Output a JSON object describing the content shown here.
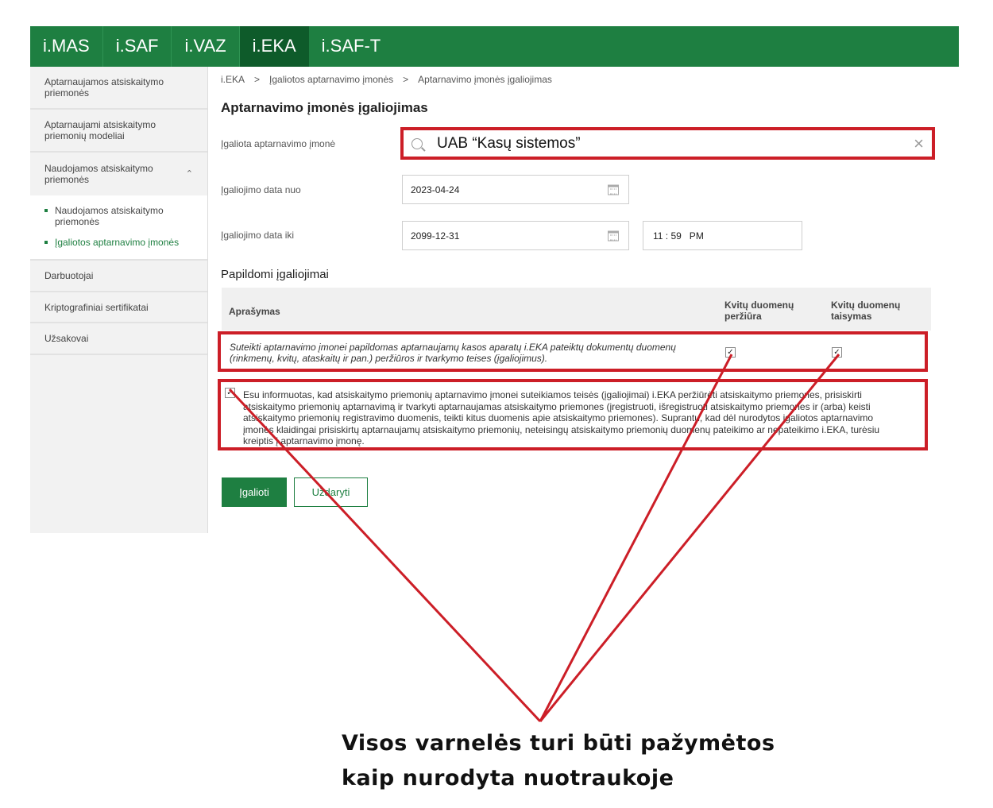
{
  "topnav": {
    "tabs": [
      {
        "label": "i.MAS"
      },
      {
        "label": "i.SAF"
      },
      {
        "label": "i.VAZ"
      },
      {
        "label": "i.EKA"
      },
      {
        "label": "i.SAF-T"
      }
    ],
    "active_tab": "i.EKA",
    "color": "#1e7f41",
    "active_color": "#0e5b2a"
  },
  "sidebar": {
    "items": [
      {
        "label": "Aptarnaujamos atsiskaitymo priemonės"
      },
      {
        "label": "Aptarnaujami atsiskaitymo priemonių modeliai"
      },
      {
        "label": "Naudojamos atsiskaitymo priemonės",
        "expanded": true,
        "icon": "chevron-up-icon"
      }
    ],
    "sub_items": [
      {
        "label": "Naudojamos atsiskaitymo priemonės"
      },
      {
        "label": "Įgaliotos aptarnavimo įmonės",
        "active": true
      }
    ],
    "items_after": [
      {
        "label": "Darbuotojai"
      },
      {
        "label": "Kriptografiniai sertifikatai"
      },
      {
        "label": "Užsakovai"
      }
    ]
  },
  "breadcrumb": {
    "items": [
      "i.EKA",
      "Įgaliotos aptarnavimo įmonės",
      "Aptarnavimo įmonės įgaliojimas"
    ],
    "separator": ">"
  },
  "page_title": "Aptarnavimo įmonės įgaliojimas",
  "form": {
    "company_label": "Įgaliota aptarnavimo įmonė",
    "company_value": "UAB “Kasų sistemos”",
    "date_from_label": "Įgaliojimo data nuo",
    "date_from_value": "2023-04-24",
    "date_to_label": "Įgaliojimo data iki",
    "date_to_value": "2099-12-31",
    "time_value": "11 : 59   PM"
  },
  "additional": {
    "title": "Papildomi įgaliojimai",
    "headers": {
      "description": "Aprašymas",
      "view": "Kvitų duomenų peržiūra",
      "edit": "Kvitų duomenų taisymas"
    },
    "row": {
      "description": "Suteikti aptarnavimo įmonei papildomas aptarnaujamų kasos aparatų i.EKA pateiktų dokumentų duomenų (rinkmenų, kvitų, ataskaitų ir pan.) peržiūros ir tvarkymo teises (įgaliojimus).",
      "view_checked": true,
      "edit_checked": true
    },
    "consent": {
      "checked": true,
      "text": "Esu informuotas, kad atsiskaitymo priemonių aptarnavimo įmonei suteikiamos teisės (įgaliojimai) i.EKA peržiūrėti atsiskaitymo priemones, prisiskirti atsiskaitymo priemonių aptarnavimą ir tvarkyti aptarnaujamas atsiskaitymo priemones (įregistruoti, išregistruoti atsiskaitymo priemones ir (arba) keisti atsiskaitymo priemonių registravimo duomenis, teikti kitus duomenis apie atsiskaitymo priemones). Suprantu, kad dėl nurodytos įgaliotos aptarnavimo įmonės klaidingai prisiskirtų aptarnaujamų atsiskaitymo priemonių, neteisingų atsiskaitymo priemonių duomenų pateikimo ar nepateikimo i.EKA, turėsiu kreiptis į aptarnavimo įmonę."
    }
  },
  "buttons": {
    "authorize": "Įgalioti",
    "close": "Uždaryti"
  },
  "annotation": {
    "caption_line1": "Visos varnelės turi būti pažymėtos",
    "caption_line2": "kaip nurodyta nuotraukoje",
    "highlight_color": "#cc1e27"
  }
}
